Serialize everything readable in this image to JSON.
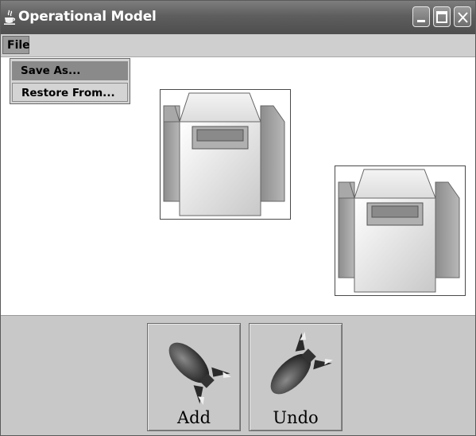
{
  "window": {
    "title": "Operational Model",
    "icons": [
      "java-cup-icon",
      "minimize-icon",
      "maximize-icon",
      "close-icon"
    ]
  },
  "menubar": {
    "file_label": "File"
  },
  "file_menu": {
    "items": [
      {
        "label": "Save As...",
        "highlighted": true
      },
      {
        "label": "Restore From..."
      }
    ]
  },
  "canvas": {
    "nodes": [
      {
        "icon": "server-icon"
      },
      {
        "icon": "server-icon"
      }
    ]
  },
  "toolbar": {
    "add_label": "Add",
    "undo_label": "Undo",
    "add_icon": "rocket-icon",
    "undo_icon": "rocket-icon"
  },
  "colors": {
    "titlebar": "#5e5e5e",
    "menubar": "#cfcfcf",
    "panel": "#c8c8c8"
  }
}
